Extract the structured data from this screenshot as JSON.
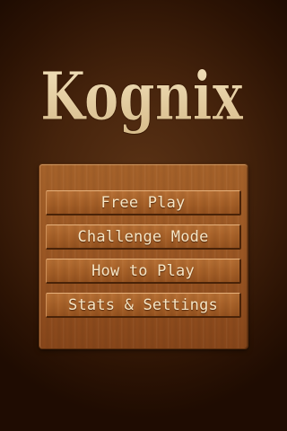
{
  "app": {
    "title": "Kognix"
  },
  "menu": {
    "items": [
      {
        "label": "Free Play"
      },
      {
        "label": "Challenge Mode"
      },
      {
        "label": "How to Play"
      },
      {
        "label": "Stats & Settings"
      }
    ]
  },
  "colors": {
    "background": "#45230c",
    "logo": "#ead3a8",
    "panel": "#9a5623",
    "button": "#a55f27",
    "button_text": "#f6e6c6"
  }
}
